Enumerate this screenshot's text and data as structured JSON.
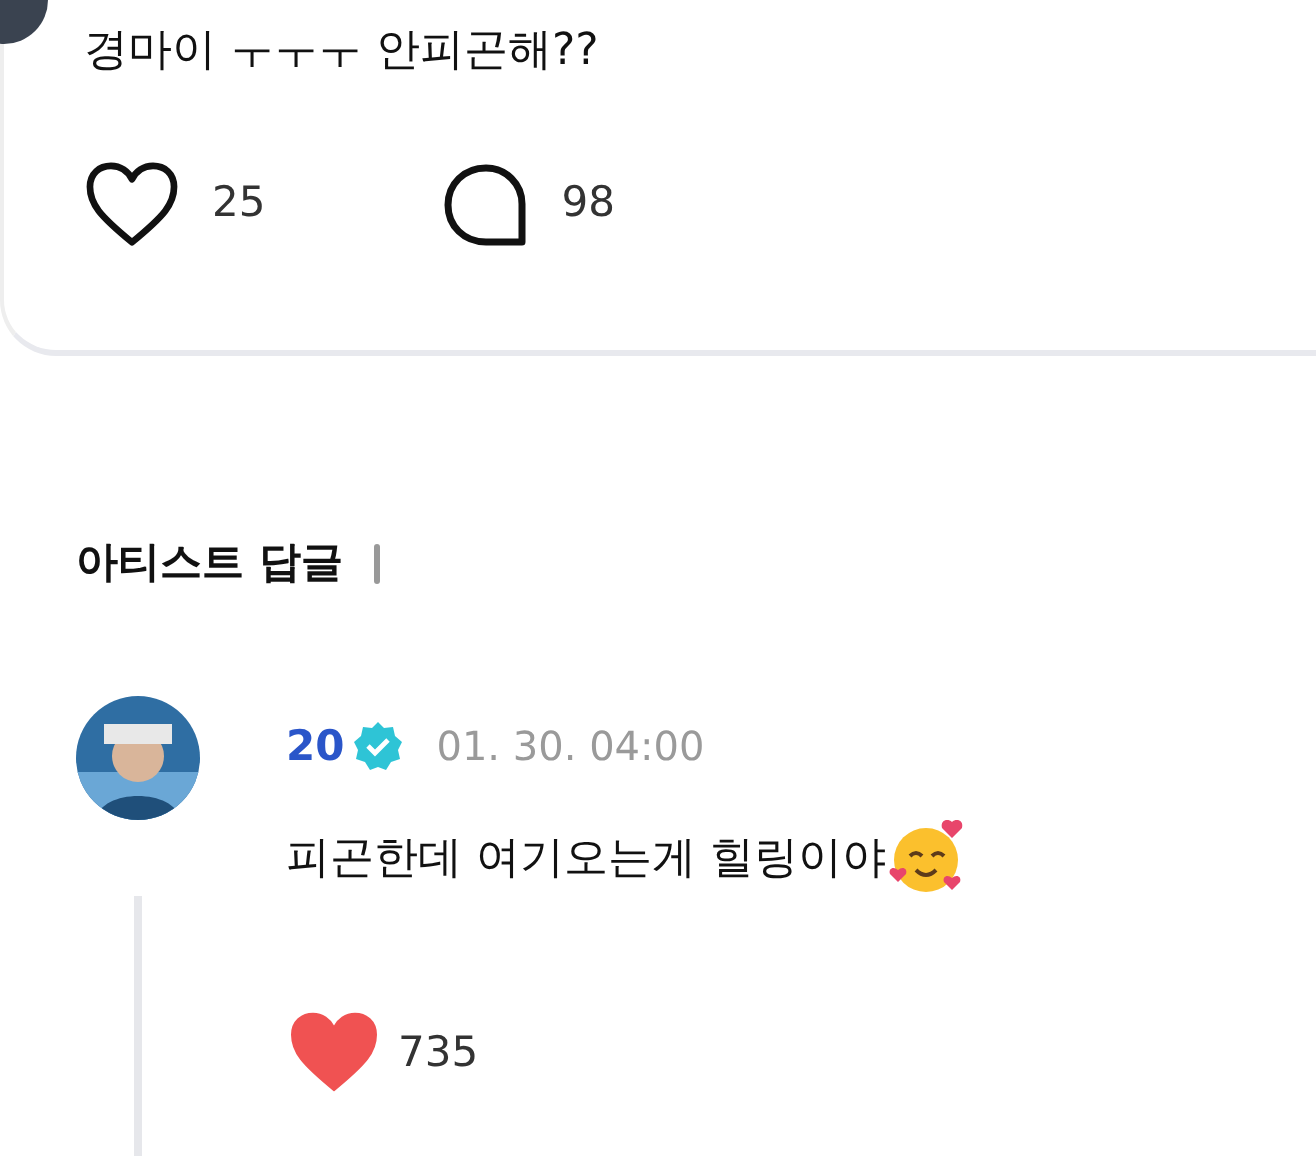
{
  "post": {
    "text": "경마이 ㅜㅜㅜ 안피곤해??",
    "likes": {
      "count": "25",
      "liked": false
    },
    "comments": {
      "count": "98"
    }
  },
  "artist_replies": {
    "heading": "아티스트 답글",
    "replies": [
      {
        "author": "20",
        "verified": true,
        "time": "01. 30. 04:00",
        "text": "피곤한데 여기오는게 힐링이야",
        "likes": {
          "count": "735",
          "liked": true
        }
      }
    ]
  }
}
